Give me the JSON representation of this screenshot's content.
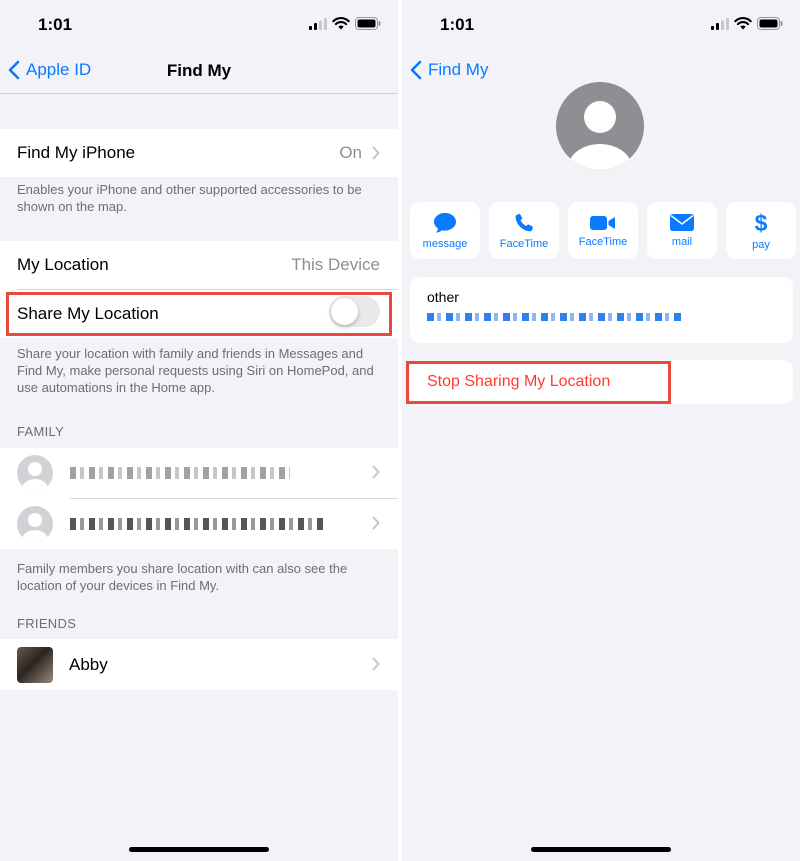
{
  "status": {
    "time": "1:01"
  },
  "left": {
    "nav": {
      "back_label": "Apple ID",
      "title": "Find My"
    },
    "find_my_iphone": {
      "label": "Find My iPhone",
      "value": "On"
    },
    "find_my_footer": "Enables your iPhone and other supported accessories to be shown on the map.",
    "my_location": {
      "label": "My Location",
      "value": "This Device"
    },
    "share_my_location": {
      "label": "Share My Location",
      "enabled": false
    },
    "share_footer": "Share your location with family and friends in Messages and Find My, make personal requests using Siri on HomePod, and use automations in the Home app.",
    "family_header": "FAMILY",
    "family_footer": "Family members you share location with can also see the location of your devices in Find My.",
    "friends_header": "FRIENDS",
    "friends": [
      {
        "name": "Abby"
      }
    ]
  },
  "right": {
    "nav": {
      "back_label": "Find My"
    },
    "actions": [
      {
        "label": "message",
        "icon": "message-icon"
      },
      {
        "label": "FaceTime",
        "icon": "phone-icon"
      },
      {
        "label": "FaceTime",
        "icon": "video-icon"
      },
      {
        "label": "mail",
        "icon": "mail-icon"
      },
      {
        "label": "pay",
        "icon": "dollar-icon"
      }
    ],
    "contact_label": "other",
    "stop_sharing_label": "Stop Sharing My Location"
  },
  "colors": {
    "accent": "#0a7aff",
    "destructive": "#ff3b30",
    "highlight": "#e64b3d"
  }
}
